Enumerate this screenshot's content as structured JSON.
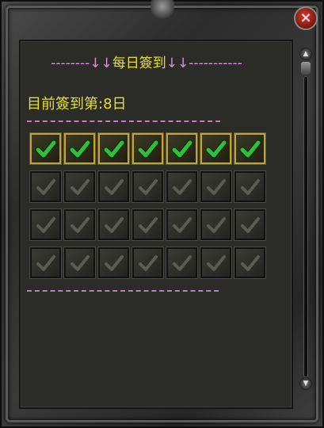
{
  "window": {
    "close_label": "×"
  },
  "header": {
    "dashes_left": "--------",
    "arrows_left": "↓↓",
    "title": "每日簽到",
    "arrows_right": "↓↓",
    "dashes_right": "-----------"
  },
  "progress": {
    "label": "目前簽到第:8日"
  },
  "calendar": {
    "columns": 7,
    "rows": 4,
    "total_days": 28,
    "checked_days": 7
  },
  "colors": {
    "title_yellow": "#e8e020",
    "divider_pink": "#c27bc2",
    "check_active": "#2fbf3a",
    "check_inactive": "#5c5c55"
  },
  "icons": {
    "close": "close-icon",
    "check": "checkmark-icon",
    "scroll_up": "chevron-up-icon",
    "scroll_down": "chevron-down-icon"
  }
}
